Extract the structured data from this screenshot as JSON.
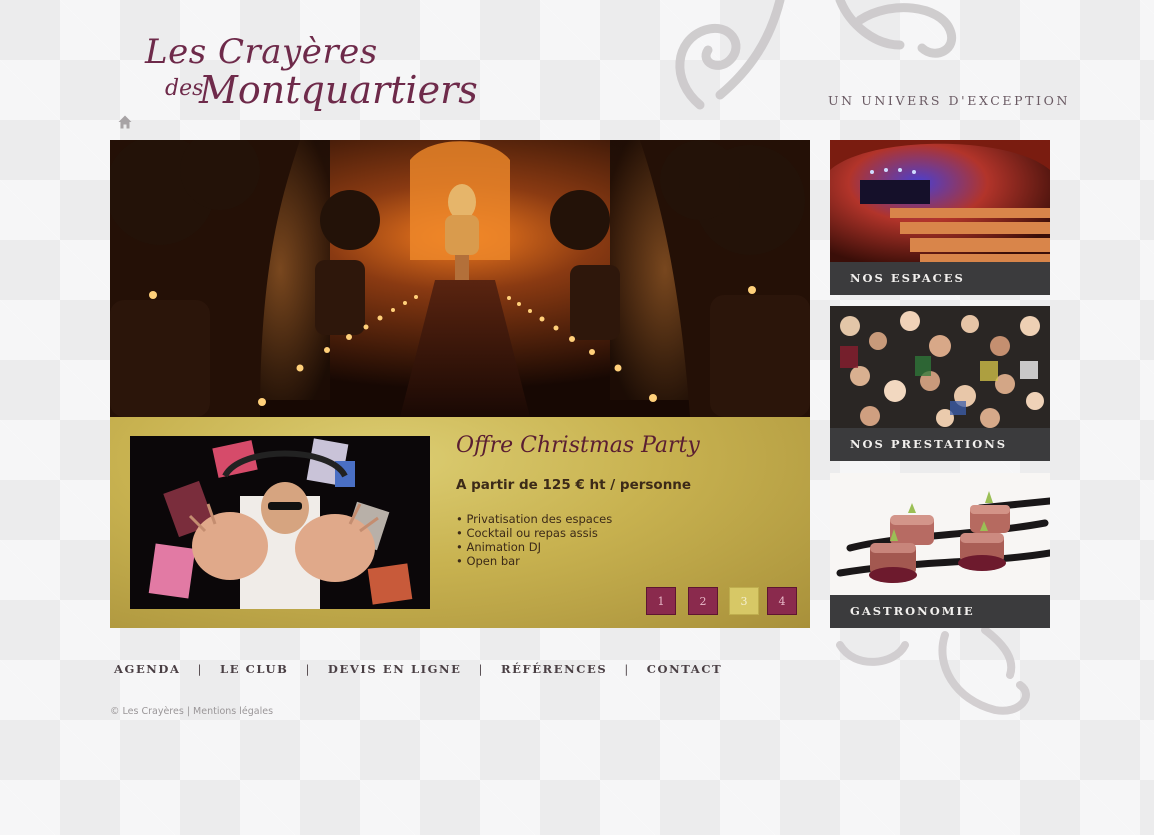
{
  "brand": {
    "line1": "Les Crayères",
    "line2a": "des",
    "line2b": "Montquartiers",
    "tagline": "UN UNIVERS D'EXCEPTION"
  },
  "nav": {
    "home_icon": "home-icon"
  },
  "promo": {
    "title": "Offre Christmas Party",
    "price": "A partir de 125 € ht / personne",
    "items": [
      "Privatisation des espaces",
      "Cocktail ou repas assis",
      "Animation DJ",
      "Open bar"
    ],
    "pager": [
      "1",
      "2",
      "3",
      "4"
    ],
    "active_page": "3"
  },
  "tiles": [
    {
      "label": "NOS ESPACES"
    },
    {
      "label": "NOS PRESTATIONS"
    },
    {
      "label": "GASTRONOMIE"
    }
  ],
  "footer": {
    "links": [
      "AGENDA",
      "LE CLUB",
      "DEVIS EN LIGNE",
      "RÉFÉRENCES",
      "CONTACT"
    ],
    "separator": "|",
    "copyright": "© Les Crayères",
    "copyright_sep": "|",
    "legal": "Mentions légales"
  },
  "colors": {
    "brand": "#6e2a4a",
    "promo_gold": "#c8b250",
    "pager_inactive": "#8a2a4d",
    "pager_active": "#d7c866",
    "tile_label_bg": "#3b3b3d"
  }
}
